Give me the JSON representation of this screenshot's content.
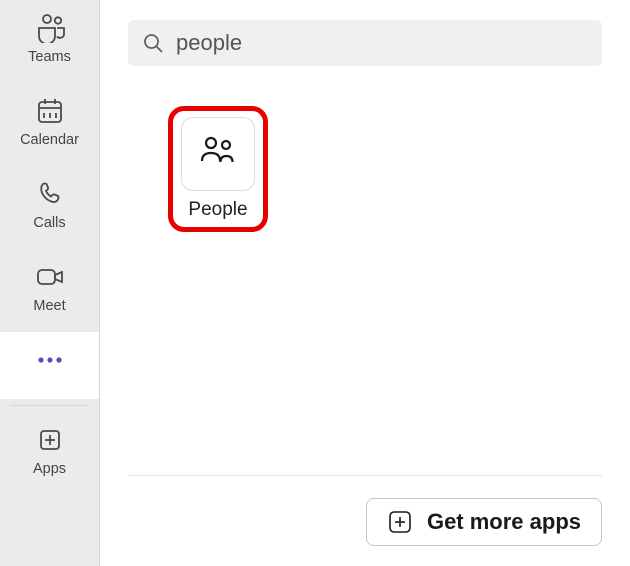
{
  "sidebar": {
    "items": [
      {
        "label": "Teams"
      },
      {
        "label": "Calendar"
      },
      {
        "label": "Calls"
      },
      {
        "label": "Meet"
      },
      {
        "label": ""
      },
      {
        "label": "Apps"
      }
    ]
  },
  "search": {
    "value": "people"
  },
  "results": [
    {
      "label": "People"
    }
  ],
  "more_apps_label": "Get more apps"
}
